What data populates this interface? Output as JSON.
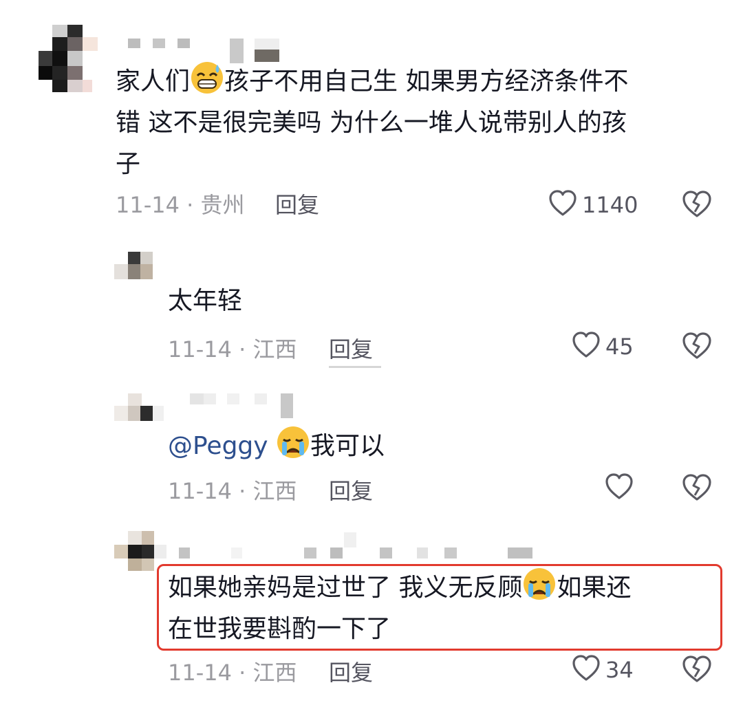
{
  "comments": [
    {
      "text": {
        "line1_a": "家人们",
        "line1_b": "孩子不用自己生 如果男方经济条件不",
        "line2": "错 这不是很完美吗 为什么一堆人说带别人的孩",
        "line3": "子"
      },
      "emoji": "grinning-sweat-emoji",
      "date_location": "11-14 · 贵州",
      "reply_label": "回复",
      "like_count": "1140"
    },
    {
      "text": {
        "line1": "太年轻"
      },
      "date_location": "11-14 · 江西",
      "reply_label": "回复",
      "like_count": "45"
    },
    {
      "text": {
        "mention": "@Peggy",
        "after_emoji": "我可以"
      },
      "emoji": "crying-emoji",
      "date_location": "11-14 · 江西",
      "reply_label": "回复",
      "like_count": ""
    },
    {
      "text": {
        "line1_a": "如果她亲妈是过世了 我义无反顾",
        "line1_b": "如果还",
        "line2": "在世我要斟酌一下了"
      },
      "emoji": "crying-emoji",
      "date_location": "11-14 · 江西",
      "reply_label": "回复",
      "like_count": "34",
      "highlight_color": "#e23a2e"
    }
  ],
  "colors": {
    "text": "#161823",
    "meta": "#9a9a9f",
    "mention": "#2d4f8e",
    "highlight": "#e23a2e"
  },
  "icons": {
    "like": "heart-icon",
    "dislike": "broken-heart-icon"
  }
}
